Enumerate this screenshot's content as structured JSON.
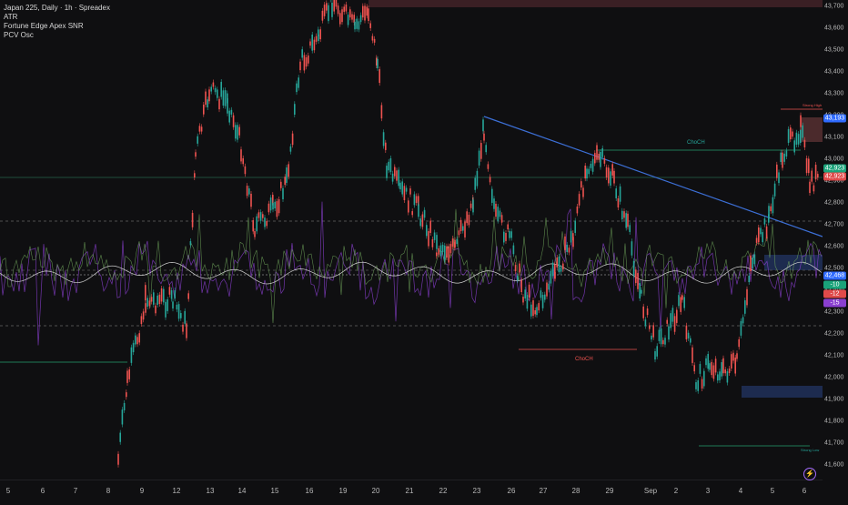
{
  "legend": {
    "title": "Japan 225, Daily · 1h · Spreadex",
    "indicator_1": "ATR",
    "indicator_2": "Fortune Edge Apex SNR",
    "indicator_3": "PCV Osc"
  },
  "price_axis": {
    "ticks": [
      "43,700",
      "43,600",
      "43,500",
      "43,400",
      "43,300",
      "43,200",
      "43,100",
      "43,000",
      "42,900",
      "42,800",
      "42,700",
      "42,600",
      "42,500",
      "42,400",
      "42,300",
      "42,200",
      "42,100",
      "42,000",
      "41,900",
      "41,800",
      "41,700",
      "41,600"
    ],
    "badges": [
      {
        "text": "43,193",
        "color": "#2f6bff"
      },
      {
        "text": "42,923",
        "color": "#1aa37a"
      },
      {
        "text": "42,923",
        "color": "#e04a4a"
      },
      {
        "text": "42,468",
        "color": "#2f6bff"
      },
      {
        "text": "-10",
        "color": "#1aa37a"
      },
      {
        "text": "-12",
        "color": "#e04a4a"
      },
      {
        "text": "-15",
        "color": "#8a3fd0"
      }
    ]
  },
  "time_axis": {
    "ticks": [
      "5",
      "6",
      "7",
      "8",
      "9",
      "12",
      "13",
      "14",
      "15",
      "16",
      "19",
      "20",
      "21",
      "22",
      "23",
      "26",
      "27",
      "28",
      "29",
      "Sep",
      "2",
      "3",
      "4",
      "5",
      "6"
    ]
  },
  "annotations": {
    "choch_up": "ChoCH",
    "choch_down": "ChoCH",
    "strong_high": "Strong High",
    "strong_low": "Strong Low"
  },
  "colors": {
    "background": "#0f0f11",
    "up_candle": "#26a69a",
    "down_candle": "#ef5350",
    "trendline": "#3c6fd6",
    "osc_purple": "#8a3fd0",
    "osc_green": "#6ea35a"
  },
  "icons": {
    "logo": "tradingview-logo-icon"
  }
}
